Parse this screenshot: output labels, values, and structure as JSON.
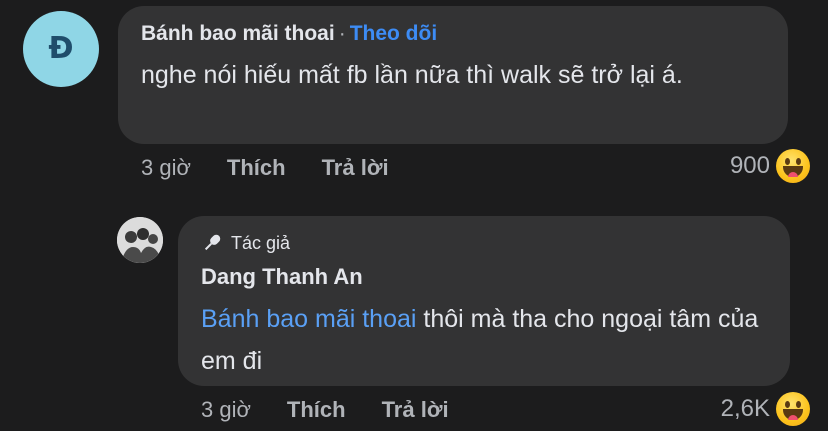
{
  "comment": {
    "avatar_letter": "Đ",
    "author": "Bánh bao mãi thoai",
    "separator": "·",
    "follow_label": "Theo dõi",
    "text": "nghe nói hiếu mất fb lần nữa thì walk sẽ trở lại á.",
    "time": "3 giờ",
    "like_label": "Thích",
    "reply_label": "Trả lời",
    "reaction_count": "900",
    "reaction_icon": "haha-emoji-icon"
  },
  "reply": {
    "badge_icon": "microphone-icon",
    "badge_label": "Tác giả",
    "author": "Dang Thanh An",
    "mention": "Bánh bao mãi thoai",
    "text": "thôi mà tha cho ngoại tâm của em đi",
    "time": "3 giờ",
    "like_label": "Thích",
    "reply_label": "Trả lời",
    "reaction_count": "2,6K",
    "reaction_icon": "haha-emoji-icon"
  },
  "colors": {
    "background": "#1c1c1d",
    "bubble": "#333334",
    "link_blue": "#3d8cf5",
    "secondary_text": "#b0b3b8"
  }
}
